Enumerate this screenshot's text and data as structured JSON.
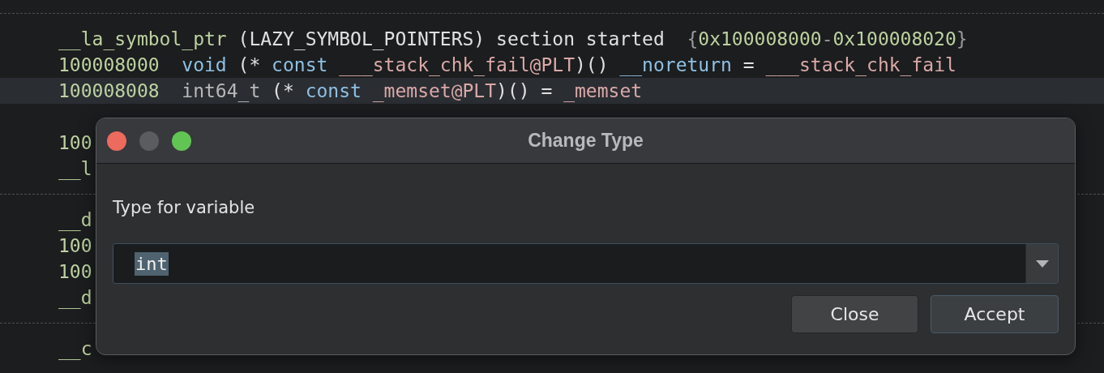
{
  "code": {
    "blocks": [
      {
        "rows": [
          {
            "selected": false,
            "segments": [
              {
                "kind": "label",
                "text": "__la_symbol_ptr"
              },
              {
                "kind": "plain",
                "text": " (LAZY_SYMBOL_POINTERS) section started  "
              },
              {
                "kind": "punct",
                "text": "{"
              },
              {
                "kind": "address",
                "text": "0x100008000"
              },
              {
                "kind": "punct",
                "text": "-"
              },
              {
                "kind": "address",
                "text": "0x100008020"
              },
              {
                "kind": "punct",
                "text": "}"
              }
            ]
          },
          {
            "selected": false,
            "segments": [
              {
                "kind": "address",
                "text": "100008000  "
              },
              {
                "kind": "keyword",
                "text": "void"
              },
              {
                "kind": "plain",
                "text": " (* "
              },
              {
                "kind": "keyword",
                "text": "const "
              },
              {
                "kind": "symbol",
                "text": "___stack_chk_fail@PLT"
              },
              {
                "kind": "plain",
                "text": ")() "
              },
              {
                "kind": "keyword",
                "text": "__noreturn"
              },
              {
                "kind": "plain",
                "text": " = "
              },
              {
                "kind": "symbol",
                "text": "___stack_chk_fail"
              }
            ]
          },
          {
            "selected": true,
            "segments": [
              {
                "kind": "address",
                "text": "100008008  "
              },
              {
                "kind": "type",
                "text": "int64_t"
              },
              {
                "kind": "plain",
                "text": " (* "
              },
              {
                "kind": "keyword",
                "text": "const "
              },
              {
                "kind": "symbol",
                "text": "_memset@PLT"
              },
              {
                "kind": "plain",
                "text": ")() = "
              },
              {
                "kind": "symbol",
                "text": "_memset"
              }
            ]
          },
          {
            "selected": false
          },
          {
            "selected": false,
            "segments": [
              {
                "kind": "address",
                "text": "100"
              }
            ]
          },
          {
            "selected": false,
            "segments": [
              {
                "kind": "label",
                "text": "__l"
              }
            ]
          }
        ]
      },
      {
        "rows": [
          {
            "selected": false,
            "segments": [
              {
                "kind": "label",
                "text": "__d"
              }
            ]
          },
          {
            "selected": false,
            "segments": [
              {
                "kind": "address",
                "text": "100"
              }
            ]
          },
          {
            "selected": false,
            "segments": [
              {
                "kind": "address",
                "text": "100"
              }
            ]
          },
          {
            "selected": false,
            "segments": [
              {
                "kind": "label",
                "text": "__d"
              }
            ]
          }
        ]
      },
      {
        "rows": [
          {
            "selected": false,
            "segments": [
              {
                "kind": "label",
                "text": "__c"
              }
            ]
          }
        ]
      }
    ]
  },
  "dialog": {
    "title": "Change Type",
    "label": "Type for variable",
    "type_field": {
      "value": "int",
      "text_selected": true
    },
    "buttons": [
      {
        "label": "Close",
        "default": false
      },
      {
        "label": "Accept",
        "default": true
      }
    ]
  }
}
